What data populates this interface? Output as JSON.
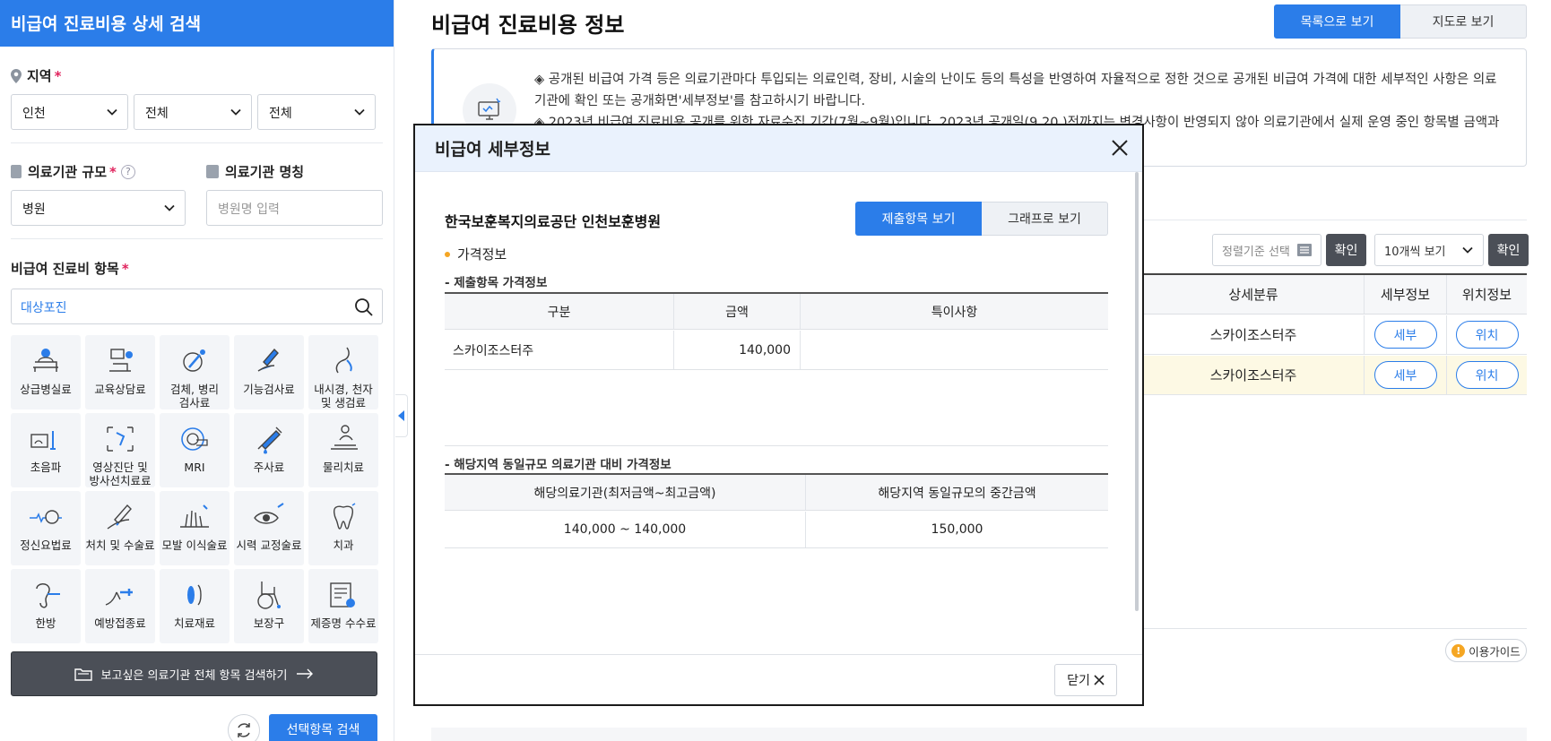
{
  "sidebar": {
    "title": "비급여 진료비용 상세 검색",
    "region": {
      "label": "지역",
      "required_mark": "*",
      "selects": [
        "인천",
        "전체",
        "전체"
      ]
    },
    "scale": {
      "label": "의료기관 규모",
      "required_mark": "*",
      "help": "?",
      "value": "병원"
    },
    "inst_name": {
      "label": "의료기관 명칭",
      "placeholder": "병원명 입력"
    },
    "items": {
      "label": "비급여 진료비 항목",
      "required_mark": "*",
      "search_value": "대상포진"
    },
    "categories": [
      {
        "label": "상급병실료",
        "icon": "hospital-bed-icon"
      },
      {
        "label": "교육상담료",
        "icon": "counseling-icon"
      },
      {
        "label": "검체, 병리\n검사료",
        "icon": "specimen-test-icon"
      },
      {
        "label": "기능검사료",
        "icon": "function-test-icon"
      },
      {
        "label": "내시경, 천자\n및 생검료",
        "icon": "endoscope-icon"
      },
      {
        "label": "초음파",
        "icon": "ultrasound-icon"
      },
      {
        "label": "영상진단 및\n방사선치료료",
        "icon": "imaging-icon"
      },
      {
        "label": "MRI",
        "icon": "mri-icon"
      },
      {
        "label": "주사료",
        "icon": "syringe-icon"
      },
      {
        "label": "물리치료",
        "icon": "physical-therapy-icon"
      },
      {
        "label": "정신요법료",
        "icon": "psychotherapy-icon"
      },
      {
        "label": "처치 및 수술료",
        "icon": "surgery-icon"
      },
      {
        "label": "모발 이식술료",
        "icon": "hair-transplant-icon"
      },
      {
        "label": "시력 교정술료",
        "icon": "eye-correction-icon"
      },
      {
        "label": "치과",
        "icon": "tooth-icon"
      },
      {
        "label": "한방",
        "icon": "oriental-medicine-icon"
      },
      {
        "label": "예방접종료",
        "icon": "vaccination-icon"
      },
      {
        "label": "치료재료",
        "icon": "treatment-material-icon"
      },
      {
        "label": "보장구",
        "icon": "wheelchair-icon"
      },
      {
        "label": "제증명 수수료",
        "icon": "certificate-icon"
      }
    ],
    "all_search_button": "보고싶은 의료기관 전체 항목 검색하기",
    "search_button": "선택항목 검색"
  },
  "main": {
    "title": "비급여 진료비용 정보",
    "view_list": "목록으로 보기",
    "view_map": "지도로 보기",
    "notice_lines": [
      "◈ 공개된 비급여 가격 등은 의료기관마다 투입되는 의료인력, 장비, 시술의 난이도 등의 특성을 반영하여 자율적으로 정한 것으로 공개된 비급여 가격에 대한 세부적인 사항은 의료기관에 확인 또는 공개화면'세부정보'를 참고하시기 바랍니다.",
      "◈ 2023년 비급여 진료비용 공개를 위한 자료수집 기간(7월~9월)입니다. 2023년 공개일(9.20.)전까지는 변경사항이 반영되지 않아 의료기관에서 실제 운영 중인 항목별 금액과"
    ],
    "sort_placeholder": "정렬기준 선택",
    "confirm": "확인",
    "per_page": "10개씩 보기",
    "table": {
      "headers": [
        "상세분류",
        "세부정보",
        "위치정보"
      ],
      "rows": [
        {
          "category": "스카이조스터주",
          "detail": "세부",
          "location": "위치"
        },
        {
          "category": "스카이조스터주",
          "detail": "세부",
          "location": "위치"
        }
      ]
    },
    "guide": "이용가이드"
  },
  "modal": {
    "title": "비급여 세부정보",
    "hospital": "한국보훈복지의료공단 인천보훈병원",
    "tab_items": "제출항목 보기",
    "tab_graph": "그래프로 보기",
    "price_info": "가격정보",
    "submitted_title": "- 제출항목 가격정보",
    "submitted_headers": [
      "구분",
      "금액",
      "특이사항"
    ],
    "submitted_rows": [
      {
        "name": "스카이조스터주",
        "amount": "140,000",
        "note": ""
      }
    ],
    "compare_title": "- 해당지역 동일규모 의료기관 대비 가격정보",
    "compare_headers": [
      "해당의료기관(최저금액~최고금액)",
      "해당지역 동일규모의 중간금액"
    ],
    "compare_row": {
      "range": "140,000 ~ 140,000",
      "median": "150,000"
    },
    "close": "닫기"
  },
  "colors": {
    "primary": "#2b7de9",
    "dark_button": "#4b4f57",
    "highlight_row": "#fdf9e4",
    "required": "#e0245e",
    "bullet": "#f5a623"
  }
}
